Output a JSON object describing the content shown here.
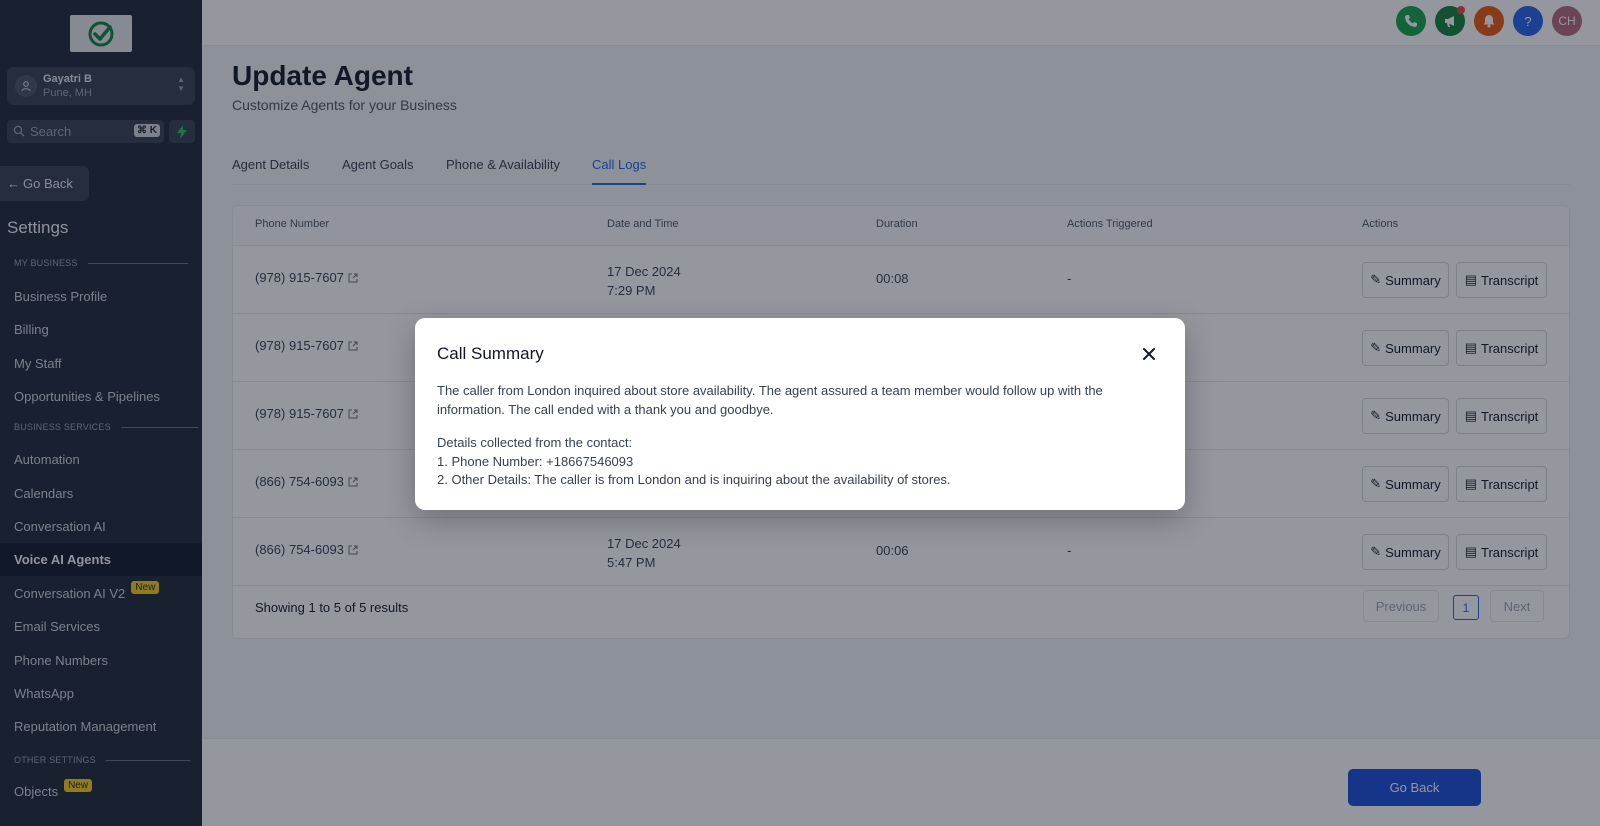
{
  "sidebar": {
    "account": {
      "name": "Gayatri B",
      "location": "Pune, MH"
    },
    "search": {
      "placeholder": "Search",
      "shortcut": "⌘ K"
    },
    "go_back": "Go Back",
    "settings_title": "Settings",
    "sections": {
      "my_business": "MY BUSINESS",
      "business_services": "BUSINESS SERVICES",
      "other_settings": "OTHER SETTINGS"
    },
    "items": [
      {
        "label": "Business Profile"
      },
      {
        "label": "Billing"
      },
      {
        "label": "My Staff"
      },
      {
        "label": "Opportunities & Pipelines"
      },
      {
        "label": "Automation"
      },
      {
        "label": "Calendars"
      },
      {
        "label": "Conversation AI"
      },
      {
        "label": "Voice AI Agents",
        "active": true
      },
      {
        "label": "Conversation AI V2",
        "badge": "New"
      },
      {
        "label": "Email Services"
      },
      {
        "label": "Phone Numbers"
      },
      {
        "label": "WhatsApp"
      },
      {
        "label": "Reputation Management"
      },
      {
        "label": "Objects",
        "badge": "New"
      }
    ]
  },
  "header": {
    "icons": [
      "phone-icon",
      "megaphone-icon",
      "bell-icon",
      "help-icon"
    ],
    "help_glyph": "?",
    "avatar_initials": "CH",
    "colors": {
      "phone": "#16a34a",
      "megaphone": "#15803d",
      "bell": "#ea580c",
      "help": "#2563eb",
      "avatar": "#b4687a"
    }
  },
  "page": {
    "title": "Update Agent",
    "subtitle": "Customize Agents for your Business",
    "tabs": [
      "Agent Details",
      "Agent Goals",
      "Phone & Availability",
      "Call Logs"
    ],
    "active_tab": "Call Logs"
  },
  "table": {
    "headers": [
      "Phone Number",
      "Date and Time",
      "Duration",
      "Actions Triggered",
      "Actions"
    ],
    "rows": [
      {
        "phone": "(978) 915-7607",
        "date": "17 Dec 2024",
        "time": "7:29 PM",
        "duration": "00:08",
        "actions": "-"
      },
      {
        "phone": "(978) 915-7607",
        "date": "",
        "time": "",
        "duration": "",
        "actions": ""
      },
      {
        "phone": "(978) 915-7607",
        "date": "",
        "time": "",
        "duration": "",
        "actions": ""
      },
      {
        "phone": "(866) 754-6093",
        "date": "",
        "time": "",
        "duration": "",
        "actions": ""
      },
      {
        "phone": "(866) 754-6093",
        "date": "17 Dec 2024",
        "time": "5:47 PM",
        "duration": "00:06",
        "actions": "-"
      }
    ],
    "summary_label": "Summary",
    "transcript_label": "Transcript",
    "showing": "Showing 1 to 5 of 5 results",
    "pagination": {
      "previous": "Previous",
      "page": "1",
      "next": "Next"
    }
  },
  "footer": {
    "go_back": "Go Back"
  },
  "modal": {
    "title": "Call Summary",
    "paragraph": "The caller from London inquired about store availability. The agent assured a team member would follow up with the information. The call ended with a thank you and goodbye.",
    "details_heading": "Details collected from the contact:",
    "detail_1": "1. Phone Number: +18667546093",
    "detail_2": "2. Other Details: The caller is from London and is inquiring about the availability of stores."
  }
}
